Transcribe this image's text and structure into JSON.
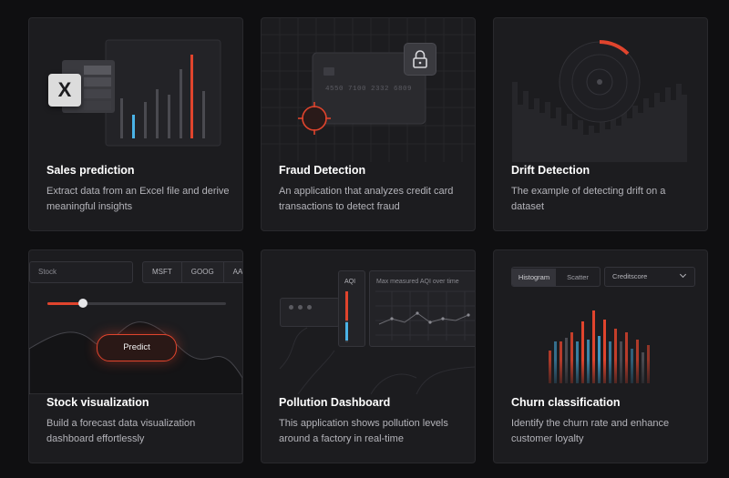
{
  "colors": {
    "background": "#0f0f11",
    "card": "#1c1c1f",
    "accent": "#e0442d",
    "blue": "#4ab3e6",
    "text_muted": "#b4b4ba"
  },
  "cards": [
    {
      "title": "Sales prediction",
      "description": "Extract data from an Excel file and derive meaningful insights",
      "excel_icon_letter": "X"
    },
    {
      "title": "Fraud Detection",
      "description": "An application that analyzes credit card transactions to detect fraud",
      "card_number": "4550 7100 2332 6809",
      "icons": [
        "lock-icon",
        "target-icon"
      ]
    },
    {
      "title": "Drift Detection",
      "description": "The example of detecting drift on a dataset"
    },
    {
      "title": "Stock visualization",
      "description": "Build a forecast data visualization dashboard effortlessly",
      "stock_placeholder": "Stock",
      "tickers": [
        "MSFT",
        "GOOG",
        "AA"
      ],
      "predict_label": "Predict",
      "slider_value": 0.2
    },
    {
      "title": "Pollution Dashboard",
      "description": "This application shows pollution levels around a factory in real-time",
      "aqi_label": "AQI",
      "chart_title": "Max measured AQI over time"
    },
    {
      "title": "Churn classification",
      "description": "Identify the churn rate and enhance customer loyalty",
      "tabs": [
        "Histogram",
        "Scatter"
      ],
      "active_tab": "Histogram",
      "select_value": "Creditscore"
    }
  ]
}
